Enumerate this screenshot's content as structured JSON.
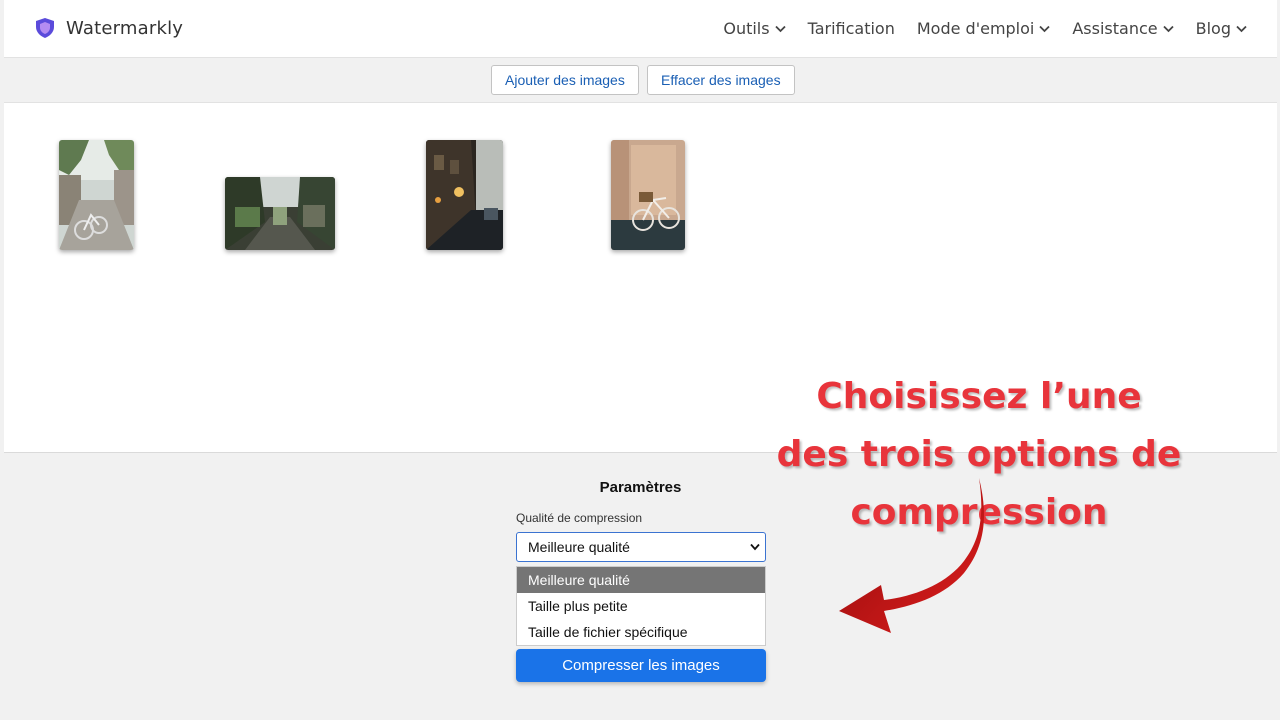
{
  "app": {
    "name": "Watermarkly",
    "brand_color": "#5b4bdb"
  },
  "nav": [
    {
      "label": "Outils",
      "has_dropdown": true
    },
    {
      "label": "Tarification",
      "has_dropdown": false
    },
    {
      "label": "Mode d'emploi",
      "has_dropdown": true
    },
    {
      "label": "Assistance",
      "has_dropdown": true
    },
    {
      "label": "Blog",
      "has_dropdown": true
    }
  ],
  "toolbar": {
    "add_label": "Ajouter des images",
    "clear_label": "Effacer des images"
  },
  "annotation": {
    "line1": "Choisissez l’une",
    "line2": "des trois options de",
    "line3": "compression",
    "color": "#e8343b"
  },
  "settings": {
    "title": "Paramètres",
    "quality_label": "Qualité de compression",
    "selected": "Meilleure qualité",
    "options": [
      "Meilleure qualité",
      "Taille plus petite",
      "Taille de fichier spécifique"
    ],
    "compress_label": "Compresser les images",
    "accent": "#1a73e8"
  }
}
